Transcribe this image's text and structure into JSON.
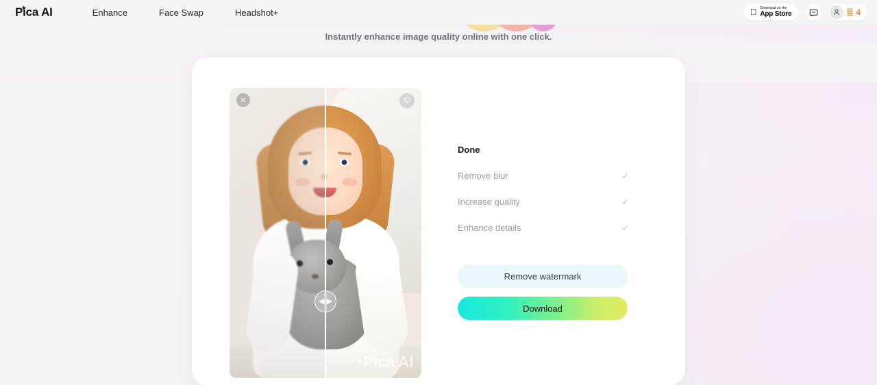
{
  "header": {
    "logo": "Pica AI",
    "logo_sparkle": "sparkle-icon",
    "nav": [
      {
        "label": "Enhance",
        "name": "nav-enhance"
      },
      {
        "label": "Face Swap",
        "name": "nav-face-swap"
      },
      {
        "label": "Headshot+",
        "name": "nav-headshot-plus"
      }
    ],
    "appstore": {
      "small": "Download on the",
      "large": "App Store",
      "icon": "apple-icon"
    },
    "chat_icon": "chat-bubble-icon",
    "avatar_icon": "user-avatar-icon",
    "credits_icon": "coin-stack-icon",
    "credits_count": "4"
  },
  "tagline": "Instantly enhance image quality online with one click.",
  "image": {
    "close_icon": "close-icon",
    "feedback_icon": "thumbs-down-icon",
    "slider_left_icon": "chevron-left-icon",
    "slider_right_icon": "chevron-right-icon",
    "watermark": "Pica AI"
  },
  "panel": {
    "title": "Done",
    "tasks": [
      {
        "label": "Remove blur",
        "status_icon": "check-icon"
      },
      {
        "label": "Increase quality",
        "status_icon": "check-icon"
      },
      {
        "label": "Enhance details",
        "status_icon": "check-icon"
      }
    ]
  },
  "actions": {
    "remove_watermark": "Remove watermark",
    "download": "Download"
  },
  "colors": {
    "accent_orange": "#f08a1e",
    "download_gradient_start": "#18e8e0",
    "download_gradient_end": "#e4ec5f",
    "secondary_button_bg": "#eaf7fa"
  }
}
